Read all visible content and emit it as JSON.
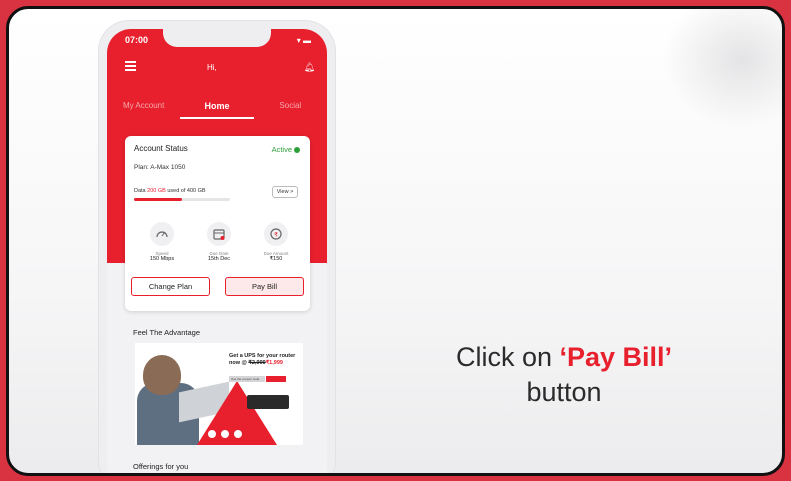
{
  "phone": {
    "status_time": "07:00",
    "greeting": "Hi,",
    "tabs": [
      {
        "label": "My Account"
      },
      {
        "label": "Home"
      },
      {
        "label": "Social"
      }
    ],
    "account_card": {
      "title": "Account Status",
      "status": "Active",
      "plan": "Plan: A-Max 1050",
      "data_prefix": "Data ",
      "data_used": "200 GB",
      "data_suffix": " used of 400 GB",
      "data_progress_fraction": 0.5,
      "view_label": "View >",
      "stats": [
        {
          "icon": "speed-gauge-icon",
          "label": "Speed",
          "value": "150 Mbps"
        },
        {
          "icon": "calendar-icon",
          "label": "Due Date",
          "value": "15th Dec"
        },
        {
          "icon": "rupee-icon",
          "label": "Due Amount",
          "value": "₹150"
        }
      ],
      "change_plan_label": "Change Plan",
      "pay_bill_label": "Pay Bill"
    },
    "advantage_title": "Feel The Advantage",
    "banner": {
      "line1": "Get a UPS for your router",
      "line2_prefix": "now @ ",
      "old_price": "₹2,999",
      "new_price": "₹1,999",
      "coupon_text": "Use the coupon code"
    },
    "offerings_title": "Offerings for you"
  },
  "instruction": {
    "prefix": "Click on ",
    "highlight": "‘Pay Bill’",
    "suffix": "button"
  },
  "colors": {
    "brand_red": "#e8202e",
    "active_green": "#2e9e3a"
  }
}
